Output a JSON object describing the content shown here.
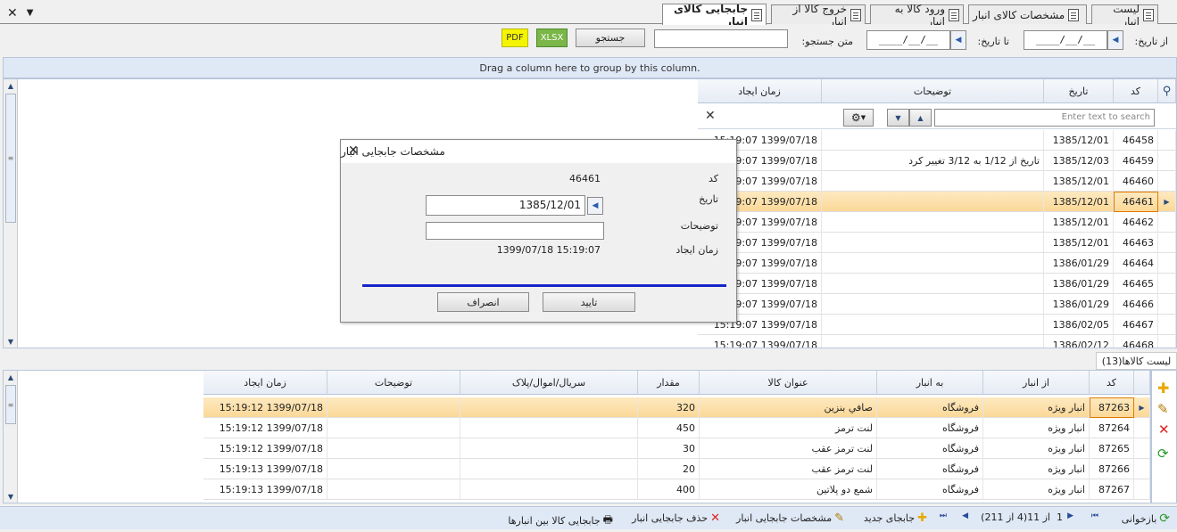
{
  "tabs": [
    {
      "label": "لیست انبار"
    },
    {
      "label": "مشخصات کالای انبار"
    },
    {
      "label": "ورود کالا به انبار"
    },
    {
      "label": "خروج کالا از انبار"
    },
    {
      "label": "جابجایی کالای انبار"
    }
  ],
  "window": {
    "close": "✕",
    "dropdown": "▼"
  },
  "filter": {
    "from_date_label": "از تاریخ:",
    "from_date_value": "____/__/__",
    "to_date_label": "تا تاریخ:",
    "to_date_value": "____/__/__",
    "search_text_label": "متن جستجو:",
    "search_text_value": "",
    "search_button": "جستجو",
    "xlsx": "XLSX",
    "pdf": "PDF"
  },
  "group_panel": "Drag a column here to group by this column.",
  "top_grid": {
    "headers": {
      "code": "کد",
      "date": "تاریخ",
      "desc": "توضیحات",
      "created": "زمان ایجاد"
    },
    "search_placeholder": "Enter text to search",
    "rows": [
      {
        "code": "46458",
        "date": "1385/12/01",
        "desc": "",
        "created": "15:19:07 1399/07/18"
      },
      {
        "code": "46459",
        "date": "1385/12/03",
        "desc": "تاریخ از 1/12 به 3/12 تغییر کرد",
        "created": "15:19:07 1399/07/18"
      },
      {
        "code": "46460",
        "date": "1385/12/01",
        "desc": "",
        "created": "15:19:07 1399/07/18"
      },
      {
        "code": "46461",
        "date": "1385/12/01",
        "desc": "",
        "created": "15:19:07 1399/07/18"
      },
      {
        "code": "46462",
        "date": "1385/12/01",
        "desc": "",
        "created": "15:19:07 1399/07/18"
      },
      {
        "code": "46463",
        "date": "1385/12/01",
        "desc": "",
        "created": "15:19:07 1399/07/18"
      },
      {
        "code": "46464",
        "date": "1386/01/29",
        "desc": "",
        "created": "15:19:07 1399/07/18"
      },
      {
        "code": "46465",
        "date": "1386/01/29",
        "desc": "",
        "created": "15:19:07 1399/07/18"
      },
      {
        "code": "46466",
        "date": "1386/01/29",
        "desc": "",
        "created": "15:19:07 1399/07/18"
      },
      {
        "code": "46467",
        "date": "1386/02/05",
        "desc": "",
        "created": "15:19:07 1399/07/18"
      },
      {
        "code": "46468",
        "date": "1386/02/12",
        "desc": "",
        "created": "15:19:07 1399/07/18"
      }
    ]
  },
  "dialog": {
    "title": "مشخصات جابجایی انبار",
    "code_label": "کد",
    "code_value": "46461",
    "date_label": "تاریخ",
    "date_value": "1385/12/01",
    "desc_label": "توضیحات",
    "desc_value": "",
    "created_label": "زمان ایجاد",
    "created_value": "15:19:07 1399/07/18",
    "ok": "تایید",
    "cancel": "انصراف"
  },
  "items_label": "لیست کالاها(13)",
  "bottom_grid": {
    "headers": {
      "code": "کد",
      "from": "از انبار",
      "to": "به انبار",
      "title": "عنوان کالا",
      "qty": "مقدار",
      "serial": "سریال/اموال/پلاک",
      "desc": "توضیحات",
      "created": "زمان ایجاد"
    },
    "rows": [
      {
        "code": "87263",
        "from": "انبار ویژه",
        "to": "فروشگاه",
        "title": "صافي بنزين",
        "qty": "320",
        "serial": "",
        "desc": "",
        "created": "15:19:12 1399/07/18"
      },
      {
        "code": "87264",
        "from": "انبار ویژه",
        "to": "فروشگاه",
        "title": "لنت ترمز",
        "qty": "450",
        "serial": "",
        "desc": "",
        "created": "15:19:12 1399/07/18"
      },
      {
        "code": "87265",
        "from": "انبار ویژه",
        "to": "فروشگاه",
        "title": "لنت ترمز عقب",
        "qty": "30",
        "serial": "",
        "desc": "",
        "created": "15:19:12 1399/07/18"
      },
      {
        "code": "87266",
        "from": "انبار ویژه",
        "to": "فروشگاه",
        "title": "لنت ترمز عقب",
        "qty": "20",
        "serial": "",
        "desc": "",
        "created": "15:19:13 1399/07/18"
      },
      {
        "code": "87267",
        "from": "انبار ویژه",
        "to": "فروشگاه",
        "title": "شمع دو پلاتین",
        "qty": "400",
        "serial": "",
        "desc": "",
        "created": "15:19:13 1399/07/18"
      }
    ]
  },
  "status": {
    "reload": "بازخوانی",
    "page_num": "1",
    "page_info": "از 11(4 از 211)",
    "new": "جابجای جدید",
    "edit": "مشخصات جابجایی انبار",
    "delete": "حذف جابجایی انبار",
    "print": "جابجایی کالا بین انبارها"
  }
}
